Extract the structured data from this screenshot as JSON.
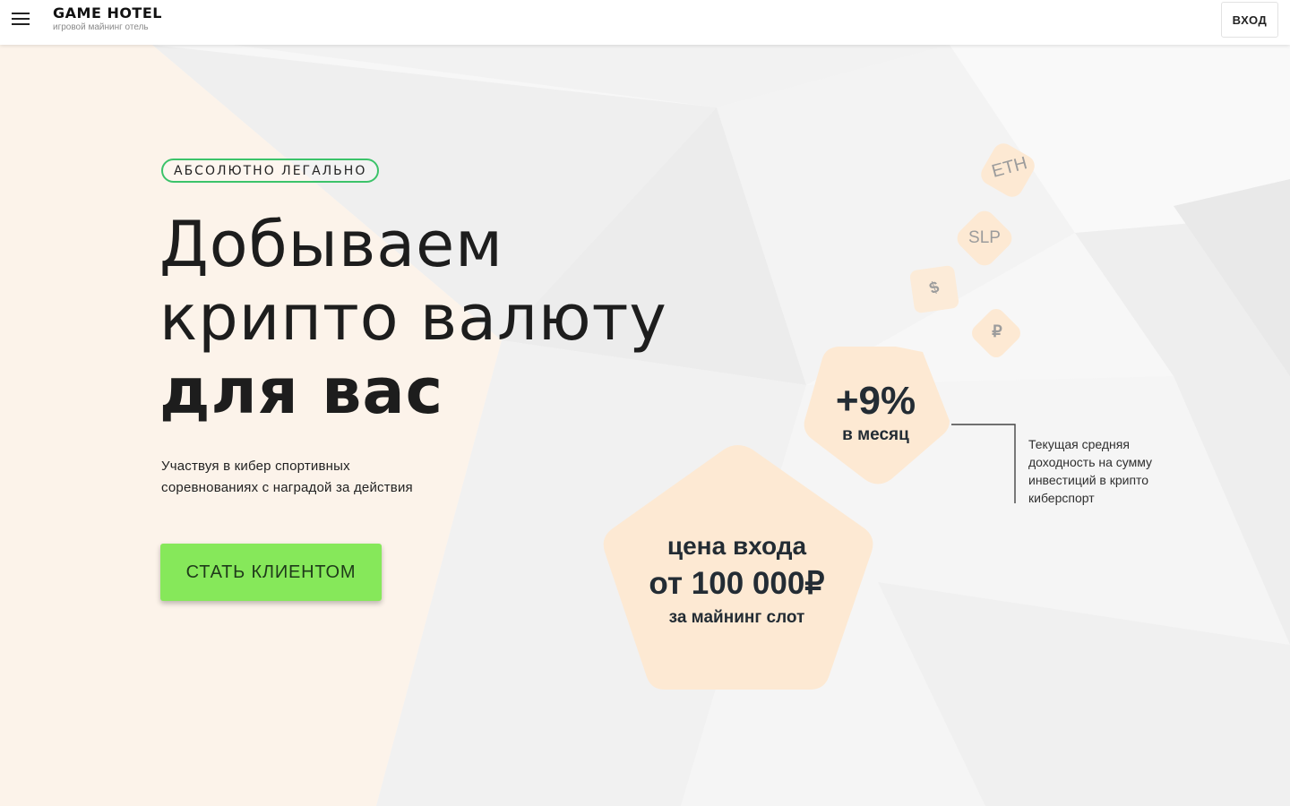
{
  "header": {
    "logo_title": "GAME HOTEL",
    "logo_subtitle": "игровой майнинг отель",
    "login_label": "ВХОД"
  },
  "hero": {
    "badge": "АБСОЛЮТНО ЛЕГАЛЬНО",
    "headline_line1": "Добываем",
    "headline_line2": "крипто валюту",
    "headline_line3": "для вас",
    "subtitle_line1": "Участвуя в кибер спортивных",
    "subtitle_line2": "соревнованиях с наградой за действия",
    "cta_label": "СТАТЬ КЛИЕНТОМ"
  },
  "coins": [
    {
      "label": "ETH",
      "icon": "eth-coin-icon"
    },
    {
      "label": "SLP",
      "icon": "slp-coin-icon"
    },
    {
      "label": "$",
      "icon": "dollar-coin-icon"
    },
    {
      "label": "₽",
      "icon": "ruble-coin-icon"
    }
  ],
  "yield": {
    "value": "+9%",
    "period": "в месяц",
    "note_line1": "Текущая средняя",
    "note_line2": "доходность на сумму",
    "note_line3": "инвестиций в крипто",
    "note_line4": "киберспорт"
  },
  "price": {
    "line1": "цена входа",
    "line2": "от 100 000₽",
    "line3": "за майнинг слот"
  },
  "colors": {
    "accent_green": "#86e85a",
    "badge_border": "#3cc36a",
    "pentagon_fill": "#fdebd3",
    "text_dark": "#232c34"
  }
}
